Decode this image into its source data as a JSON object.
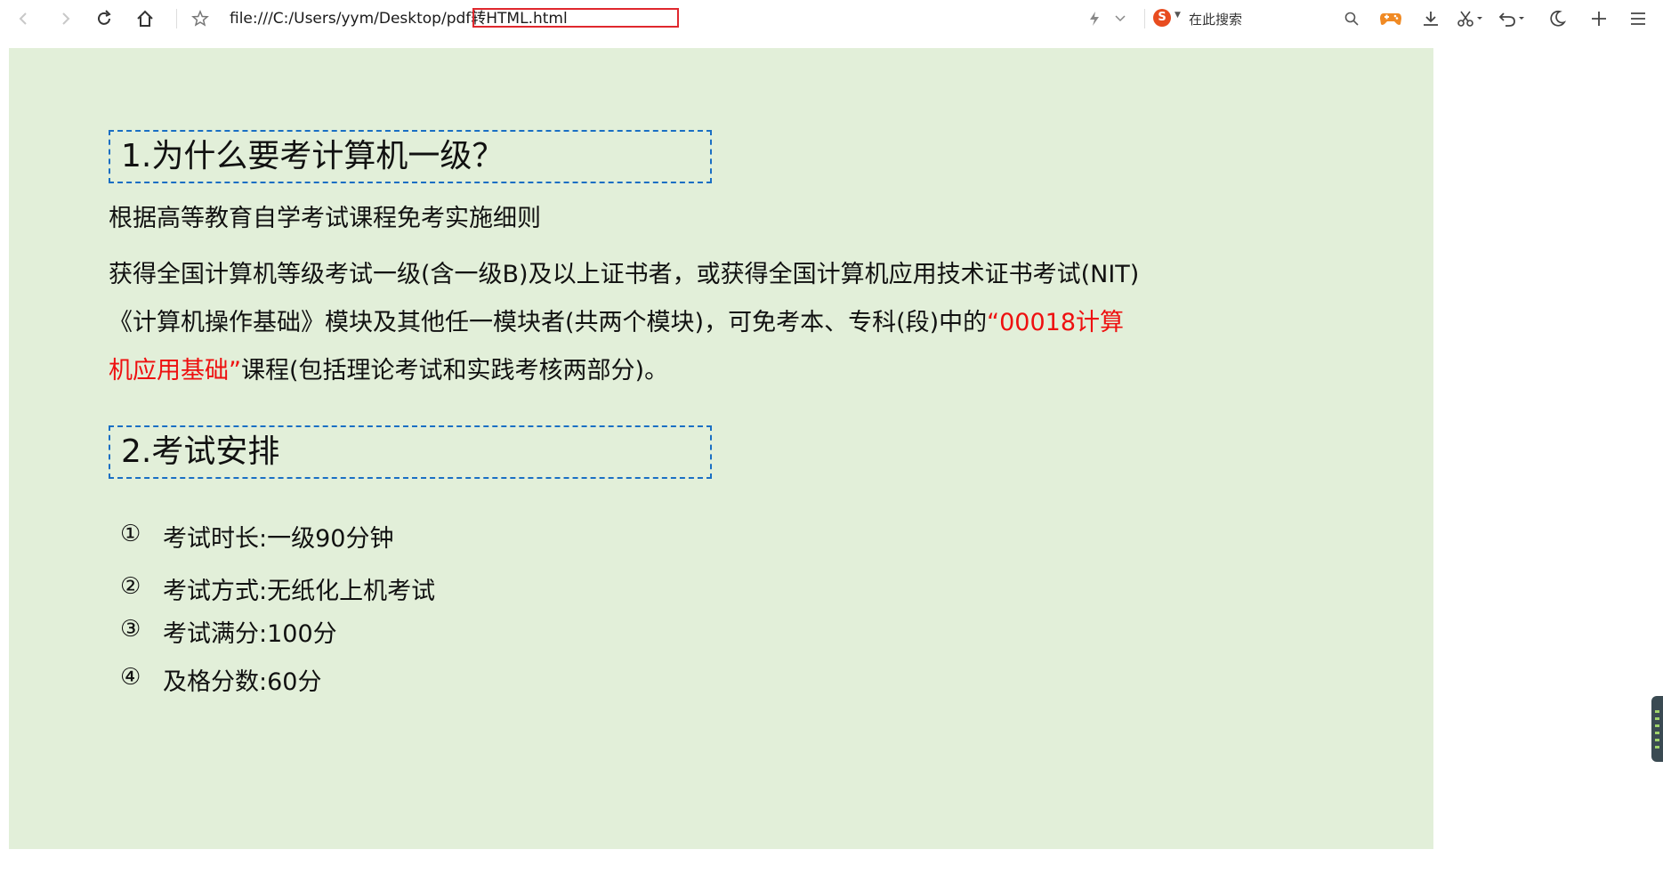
{
  "browser": {
    "url": "file:///C:/Users/yym/Desktop/pdf转HTML.html",
    "search_logo": "S",
    "search_placeholder": "在此搜索",
    "icons": {
      "back": "chevron-left-icon",
      "forward": "chevron-right-icon",
      "refresh": "refresh-icon",
      "home": "home-icon",
      "bookmark": "star-icon",
      "lightning": "lightning-icon",
      "dropdown": "chevron-down-icon",
      "search": "search-icon",
      "game": "gamepad-icon",
      "download": "download-icon",
      "screenshot": "scissors-icon",
      "undo": "undo-icon",
      "night_mode": "moon-icon",
      "new_tab": "plus-icon",
      "menu": "menu-icon"
    },
    "colors": {
      "url_highlight": "#e0282e",
      "search_logo_bg": "#e84c1f",
      "game_icon": "#f08a24"
    }
  },
  "document": {
    "background": "#e2efd9",
    "section1": {
      "heading": "1.为什么要考计算机一级？",
      "subtitle": "根据高等教育自学考试课程免考实施细则",
      "line1": "获得全国计算机等级考试一级(含一级B)及以上证书者，或获得全国计算机应用技术证书考试(NIT)",
      "line2_a": "《计算机操作基础》模块及其他任一模块者(共两个模块)，可免考本、专科(段)中的",
      "line2_b": "“00018计算",
      "line3_a": "机应用基础”",
      "line3_b": "课程(包括理论考试和实践考核两部分)。"
    },
    "section2": {
      "heading": "2.考试安排",
      "items": [
        {
          "num": "①",
          "text": "考试时长:一级90分钟"
        },
        {
          "num": "②",
          "text": "考试方式:无纸化上机考试"
        },
        {
          "num": "③",
          "text": "考试满分:100分"
        },
        {
          "num": "④",
          "text": "及格分数:60分"
        }
      ]
    },
    "colors": {
      "heading_border": "#1a6fc4",
      "highlight_text": "#ee1010"
    }
  }
}
